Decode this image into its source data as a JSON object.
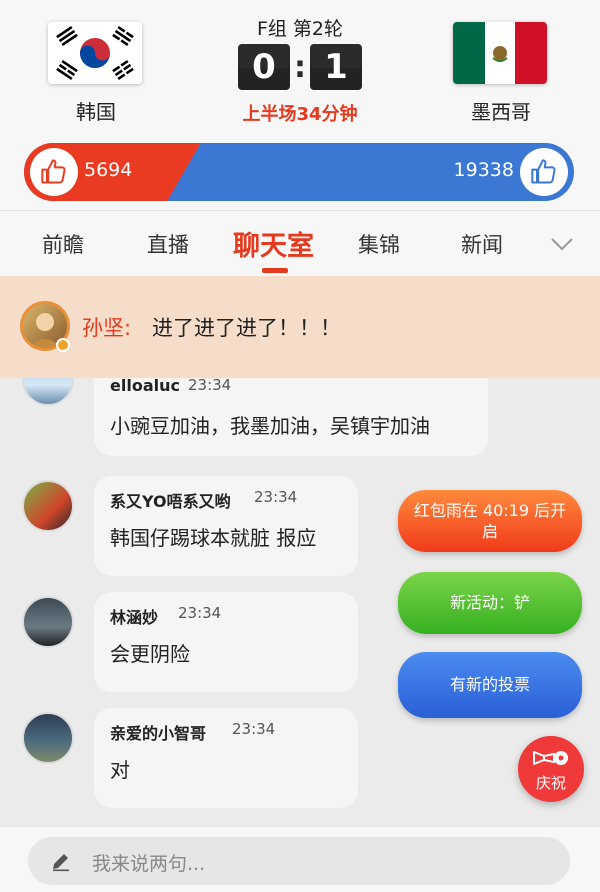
{
  "match": {
    "group": "F组 第2轮",
    "home_team": "韩国",
    "away_team": "墨西哥",
    "home_score": "0",
    "away_score": "1",
    "status": "上半场34分钟"
  },
  "support": {
    "home_likes": "5694",
    "away_likes": "19338",
    "home_fraction": 0.227,
    "home_color": "#ea3a22",
    "away_color": "#3a78d4"
  },
  "tabs": [
    {
      "label": "前瞻"
    },
    {
      "label": "直播"
    },
    {
      "label": "聊天室"
    },
    {
      "label": "集锦"
    },
    {
      "label": "新闻"
    }
  ],
  "active_tab": "聊天室",
  "pinned": {
    "name": "孙坚:",
    "text": "进了进了进了！！！"
  },
  "messages": [
    {
      "user": "elloaluc",
      "time": "23:34",
      "text": "小豌豆加油，我墨加油，吴镇宇加油"
    },
    {
      "user": "系又YO唔系又哟",
      "time": "23:34",
      "text": "韩国仔踢球本就脏 报应"
    },
    {
      "user": "林涵妙",
      "time": "23:34",
      "text": "会更阴险"
    },
    {
      "user": "亲爱的小智哥",
      "time": "23:34",
      "text": "对"
    }
  ],
  "floating": {
    "red_envelope_line1": "红包雨在 40:19 后开",
    "red_envelope_line2": "启",
    "activity": "新活动：铲",
    "vote": "有新的投票",
    "celebrate": "庆祝"
  },
  "input": {
    "placeholder": "我来说两句..."
  },
  "icons": {
    "like": "thumbs-up-icon",
    "chevron": "chevron-down-icon",
    "pencil": "pencil-icon",
    "celebrate": "trumpet-ball-icon"
  }
}
